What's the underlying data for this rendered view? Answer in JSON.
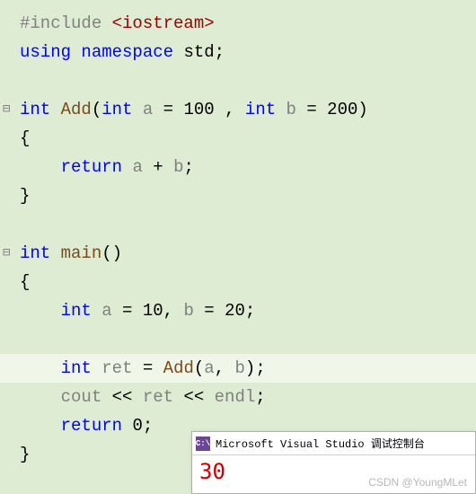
{
  "code": {
    "line1_directive": "#include",
    "line1_header": " <iostream>",
    "line2_kw1": "using",
    "line2_txt": " ",
    "line2_kw2": "namespace",
    "line2_txt2": " std;",
    "line4_kw": "int",
    "line4_func": " Add",
    "line4_p1": "(",
    "line4_kw2": "int",
    "line4_sp1": " ",
    "line4_var1": "a",
    "line4_eq1": " = ",
    "line4_num1": "100",
    "line4_comma": " , ",
    "line4_kw3": "int",
    "line4_sp2": " ",
    "line4_var2": "b",
    "line4_eq2": " = ",
    "line4_num2": "200",
    "line4_p2": ")",
    "line5": "{",
    "line6_indent": "    ",
    "line6_kw": "return",
    "line6_sp": " ",
    "line6_var1": "a",
    "line6_plus": " + ",
    "line6_var2": "b",
    "line6_semi": ";",
    "line7": "}",
    "line9_kw": "int",
    "line9_func": " main",
    "line9_paren": "()",
    "line10": "{",
    "line11_indent": "    ",
    "line11_kw": "int",
    "line11_sp": " ",
    "line11_var1": "a",
    "line11_eq1": " = ",
    "line11_num1": "10",
    "line11_comma": ", ",
    "line11_var2": "b",
    "line11_eq2": " = ",
    "line11_num2": "20",
    "line11_semi": ";",
    "line13_indent": "    ",
    "line13_kw": "int",
    "line13_sp": " ",
    "line13_var": "ret",
    "line13_eq": " = ",
    "line13_func": "Add",
    "line13_p1": "(",
    "line13_var2": "a",
    "line13_comma": ", ",
    "line13_var3": "b",
    "line13_p2": ");",
    "line14_indent": "    ",
    "line14_var": "cout",
    "line14_op1": " << ",
    "line14_var2": "ret",
    "line14_op2": " << ",
    "line14_var3": "endl",
    "line14_semi": ";",
    "line15_indent": "    ",
    "line15_kw": "return",
    "line15_sp": " ",
    "line15_num": "0",
    "line15_semi": ";",
    "line16": "}",
    "collapse_marker": "⊟"
  },
  "console": {
    "icon_text": "C:\\",
    "title": "Microsoft Visual Studio 调试控制台",
    "output": "30"
  },
  "watermark": "CSDN @YoungMLet"
}
